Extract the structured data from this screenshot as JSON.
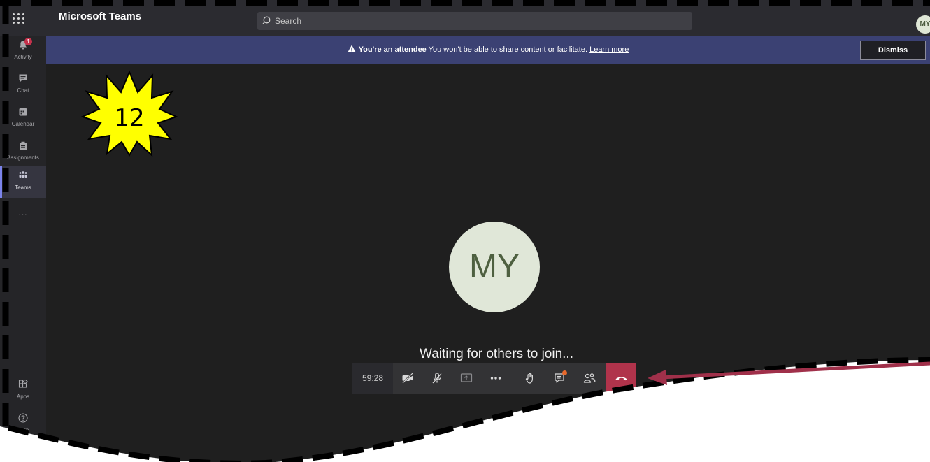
{
  "header": {
    "app_title": "Microsoft Teams",
    "search_placeholder": "Search",
    "avatar_initials": "MY"
  },
  "sidebar": {
    "items": [
      {
        "label": "Activity",
        "icon": "bell-icon",
        "badge": "1"
      },
      {
        "label": "Chat",
        "icon": "chat-icon"
      },
      {
        "label": "Calendar",
        "icon": "calendar-icon"
      },
      {
        "label": "Assignments",
        "icon": "assignments-icon"
      },
      {
        "label": "Teams",
        "icon": "teams-icon",
        "active": true
      }
    ],
    "more": "...",
    "bottom": [
      {
        "label": "Apps",
        "icon": "apps-icon"
      },
      {
        "label": "Help",
        "icon": "help-icon"
      }
    ]
  },
  "banner": {
    "title": "You're an attendee",
    "message": "You won't be able to share content or facilitate.",
    "link": "Learn more",
    "dismiss": "Dismiss"
  },
  "meeting": {
    "avatar_initials": "MY",
    "status": "Waiting for others to join..."
  },
  "controls": {
    "timer": "59:28",
    "buttons": [
      "camera-off-icon",
      "mic-off-icon",
      "share-screen-icon",
      "more-icon",
      "raise-hand-icon",
      "chat-icon",
      "participants-icon",
      "hang-up-icon"
    ]
  },
  "annotation": {
    "step_number": "12",
    "star_color": "#ffff00",
    "arrow_color": "#a0304a"
  },
  "colors": {
    "accent": "#7b83eb",
    "banner": "#3b4173",
    "hangup": "#b0334b"
  }
}
